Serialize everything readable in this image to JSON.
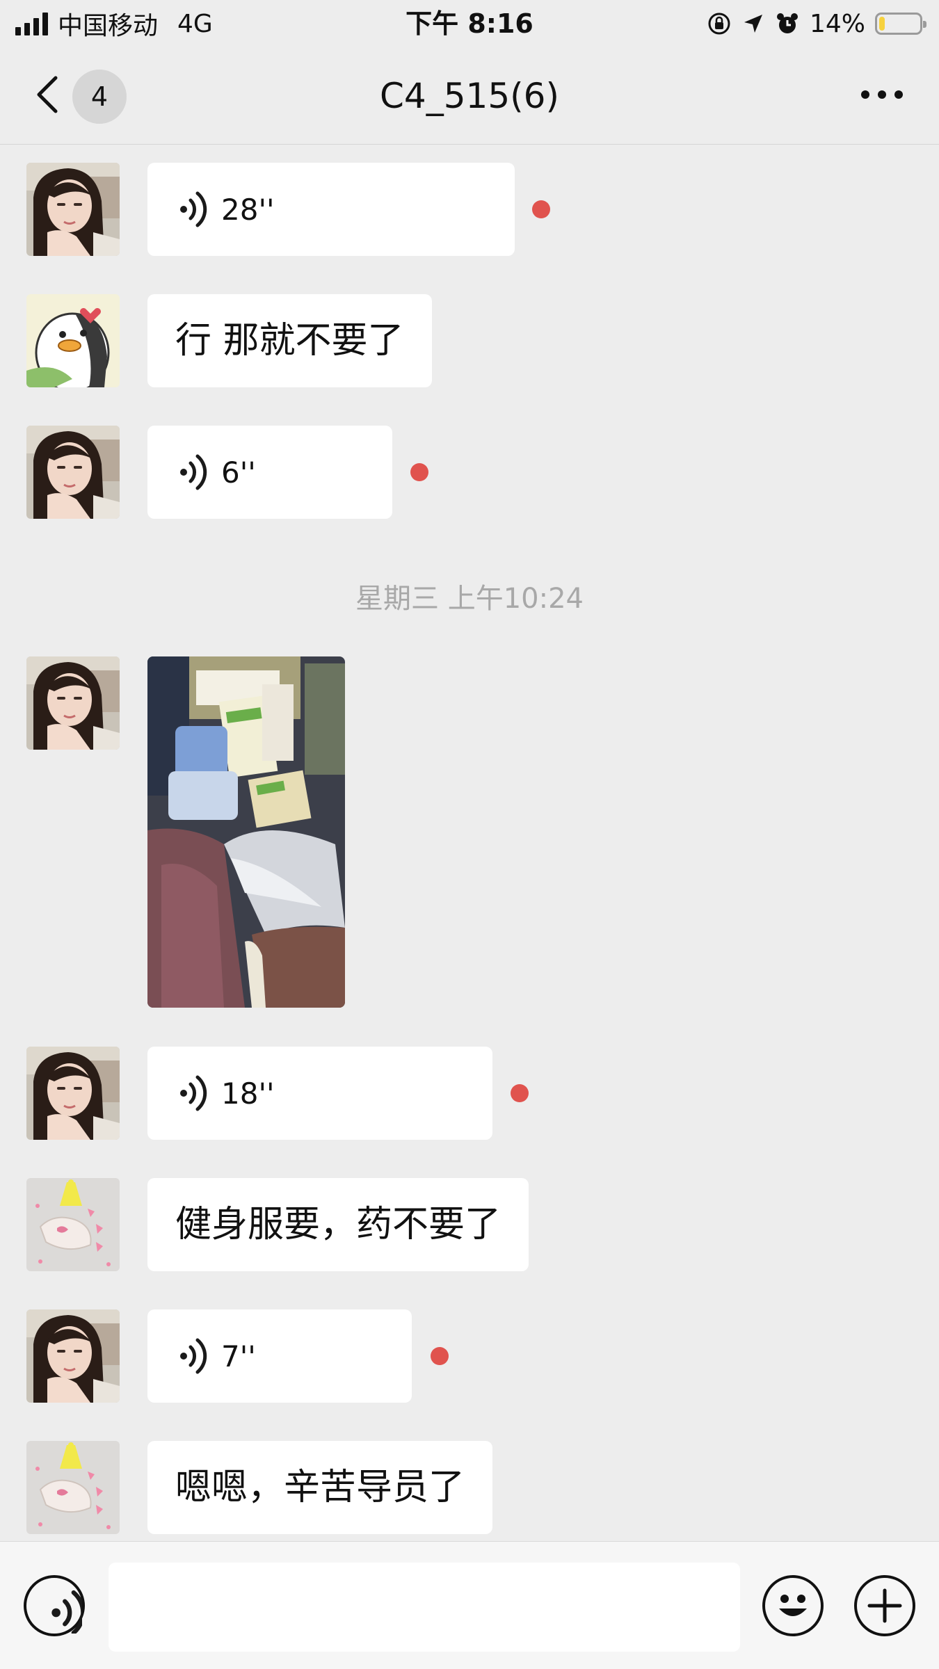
{
  "status_bar": {
    "carrier": "中国移动",
    "network": "4G",
    "time": "下午 8:16",
    "battery_percent": "14%",
    "battery_level": 0.14,
    "battery_color": "#f7d23e"
  },
  "nav": {
    "back_icon": "chevron-left-icon",
    "unread_count": "4",
    "title": "C4_515(6)",
    "more_icon": "more-dots-icon"
  },
  "messages": [
    {
      "type": "voice",
      "avatar": "girl-photo",
      "duration": "28''",
      "unread": true
    },
    {
      "type": "text",
      "avatar": "penguin-sticker",
      "text": "行 那就不要了"
    },
    {
      "type": "voice",
      "avatar": "girl-photo",
      "duration": "6''",
      "unread": true
    },
    {
      "type": "timestamp",
      "text": "星期三 上午10:24"
    },
    {
      "type": "image",
      "avatar": "girl-photo",
      "image_subject": "box of medicine and clothes"
    },
    {
      "type": "voice",
      "avatar": "girl-photo",
      "duration": "18''",
      "unread": true
    },
    {
      "type": "text",
      "avatar": "party-hat-hand",
      "text": "健身服要，药不要了"
    },
    {
      "type": "voice",
      "avatar": "girl-photo",
      "duration": "7''",
      "unread": true
    },
    {
      "type": "text",
      "avatar": "party-hat-hand",
      "text": "嗯嗯，辛苦导员了"
    }
  ],
  "input_bar": {
    "voice_button_icon": "voice-mode-icon",
    "message_value": "",
    "emoji_button_icon": "emoji-icon",
    "add_button_icon": "plus-icon"
  },
  "colors": {
    "background": "#ededed",
    "bubble": "#ffffff",
    "unread_dot": "#e0534e"
  }
}
